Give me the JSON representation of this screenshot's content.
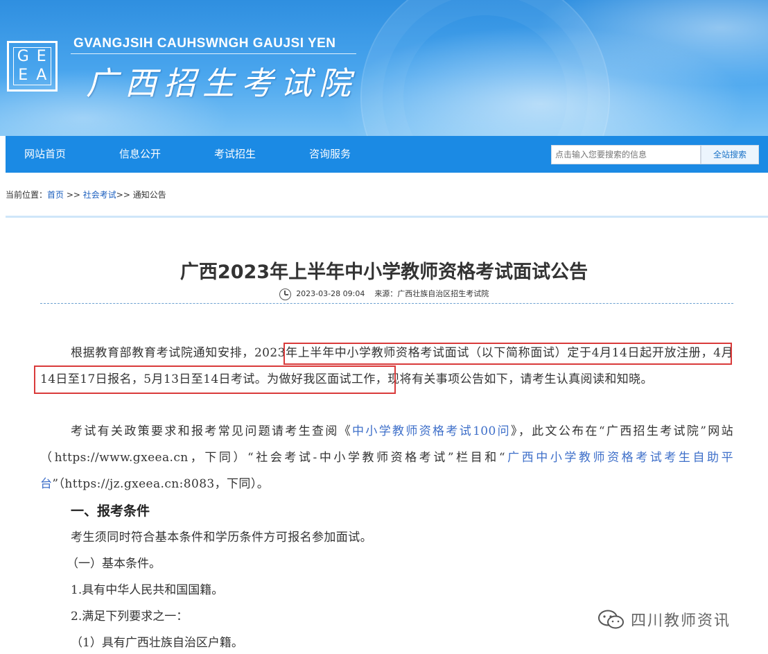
{
  "header": {
    "logo_letters": [
      "G",
      "E",
      "E",
      "A"
    ],
    "site_name_en": "GVANGJSIH CAUHSWNGH GAUJSI YEN",
    "site_name_cn": "广西招生考试院"
  },
  "nav": {
    "items": [
      "网站首页",
      "信息公开",
      "考试招生",
      "咨询服务"
    ],
    "search_placeholder": "点击输入您要搜索的信息",
    "search_button": "全站搜索"
  },
  "breadcrumb": {
    "prefix": "当前位置：",
    "home": "首页",
    "sep1": " >> ",
    "section": "社会考试",
    "sep2": ">> ",
    "current": "通知公告"
  },
  "article": {
    "title": "广西2023年上半年中小学教师资格考试面试公告",
    "date": "2023-03-28 09:04",
    "source_label": "来源：",
    "source": "广西壮族自治区招生考试院",
    "p1_a": "根据教育部教育考试院通知安排，",
    "p1_b": "2023年上半年中小学教师资格考试面试（以下简称面试）定于4月14日起开放注册，4月14日至17日报名，5月13日至14日考试",
    "p1_c": "。为做好我区面试工作，现将有关事项公告如下，请考生认真阅读和知晓。",
    "p2_a": "考试有关政策要求和报考常见问题请考生查阅《",
    "p2_link1": "中小学教师资格考试100问",
    "p2_b": "》，此文公布在“广西招生考试院”网站（https://www.gxeea.cn，下同）“社会考试-中小学教师资格考试”栏目和“",
    "p2_link2": "广西中小学教师资格考试考生自助平台",
    "p2_c": "”（https://jz.gxeea.cn:8083，下同）。",
    "h1": "一、报考条件",
    "p3": "考生须同时符合基本条件和学历条件方可报名参加面试。",
    "p4": "（一）基本条件。",
    "p5": "1.具有中华人民共和国国籍。",
    "p6": "2.满足下列要求之一：",
    "p7": "（1）具有广西壮族自治区户籍。"
  },
  "watermark": {
    "text": "四川教师资讯"
  },
  "colors": {
    "nav_bg": "#1b8ae4",
    "link": "#3e6fc9",
    "highlight_box": "#d93a3a"
  }
}
